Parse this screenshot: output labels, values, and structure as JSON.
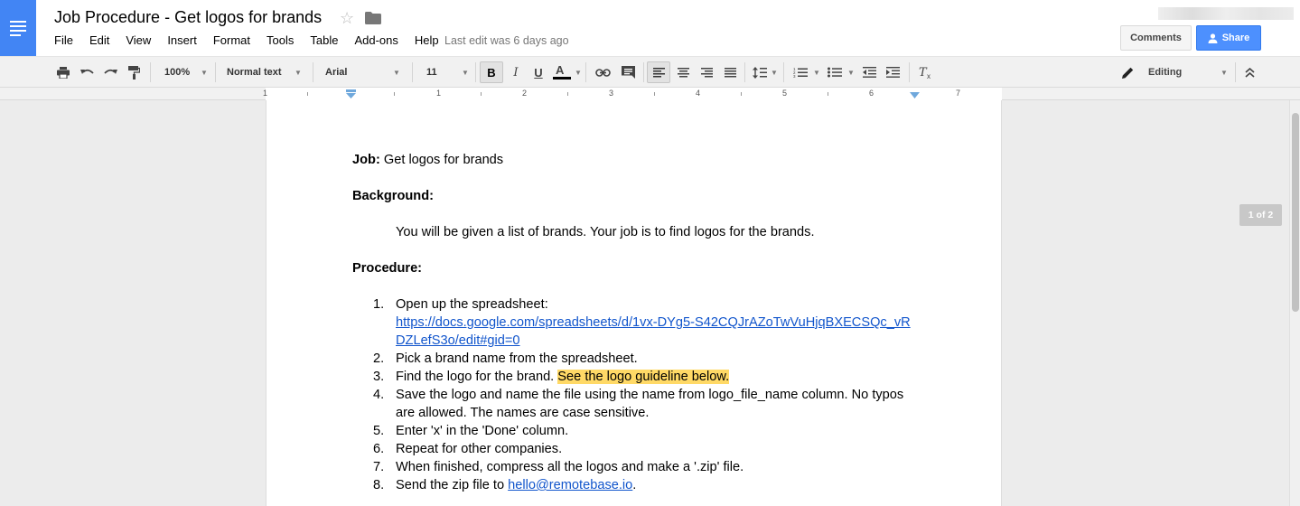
{
  "header": {
    "title": "Job Procedure - Get logos for brands",
    "last_edit": "Last edit was 6 days ago",
    "menu": [
      "File",
      "Edit",
      "View",
      "Insert",
      "Format",
      "Tools",
      "Table",
      "Add-ons",
      "Help"
    ],
    "comments_label": "Comments",
    "share_label": "Share"
  },
  "toolbar": {
    "zoom": "100%",
    "style": "Normal text",
    "font": "Arial",
    "font_size": "11",
    "mode": "Editing",
    "icons": [
      "print-icon",
      "undo-icon",
      "redo-icon",
      "paint-format-icon",
      "bold-icon",
      "italic-icon",
      "underline-icon",
      "text-color-icon",
      "link-icon",
      "comment-icon",
      "align-left-icon",
      "align-center-icon",
      "align-right-icon",
      "justify-icon",
      "line-spacing-icon",
      "numbered-list-icon",
      "bulleted-list-icon",
      "decrease-indent-icon",
      "increase-indent-icon",
      "clear-formatting-icon",
      "pencil-icon",
      "collapse-icon"
    ]
  },
  "ruler": {
    "marks": [
      "1",
      "1",
      "2",
      "3",
      "4",
      "5",
      "6",
      "7"
    ]
  },
  "document": {
    "job_label": "Job:",
    "job_text": " Get logos for brands",
    "background_heading": "Background:",
    "background_text": "You will be given a list of brands. Your job is to find logos for the brands.",
    "procedure_heading": "Procedure:",
    "steps": [
      {
        "num": "1.",
        "text": "Open up the spreadsheet:",
        "link_line1": "https://docs.google.com/spreadsheets/d/1vx-DYg5-S42CQJrAZoTwVuHjqBXECSQc_vR",
        "link_line2": "DZLefS3o/edit#gid=0"
      },
      {
        "num": "2.",
        "text": "Pick a brand name from the spreadsheet."
      },
      {
        "num": "3.",
        "text": "Find the logo for the brand. ",
        "highlight": "See the logo guideline below."
      },
      {
        "num": "4.",
        "text": "Save the logo and name the file using the name from logo_file_name column. No typos",
        "text2": "are allowed. The names are case sensitive."
      },
      {
        "num": "5.",
        "text": "Enter 'x' in the 'Done' column."
      },
      {
        "num": "6.",
        "text": "Repeat for other companies."
      },
      {
        "num": "7.",
        "text": "When finished, compress all the logos and make a '.zip' file."
      },
      {
        "num": "8.",
        "text": "Send the zip file to ",
        "link": "hello@remotebase.io",
        "after": "."
      }
    ]
  },
  "page_indicator": "1 of 2",
  "colors": {
    "brand_blue": "#4285f4",
    "share_blue": "#4d90fe",
    "link": "#1155cc",
    "highlight": "#ffd966"
  }
}
